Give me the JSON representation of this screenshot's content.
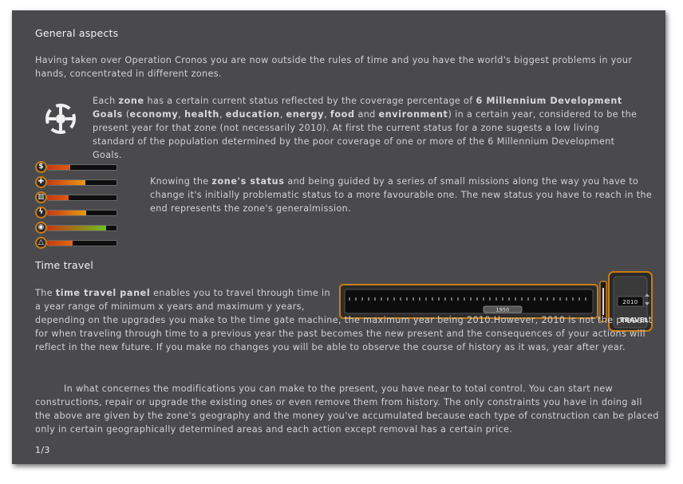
{
  "page": {
    "section1_title": "General aspects",
    "intro": "Having taken over Operation Cronos you are now outside the rules of time and you have the world's biggest problems in your hands, concentrated in different zones.",
    "zone_para": {
      "t1": "Each ",
      "b1": "zone",
      "t2": " has a certain current status reflected by the coverage percentage of ",
      "b2": "6 Millennium Development Goals",
      "t3": " (",
      "b3": "economy",
      "t4": ", ",
      "b4": "health",
      "t5": ", ",
      "b5": "education",
      "t6": ", ",
      "b6": "energy",
      "t7": ", ",
      "b7": "food",
      "t8": " and ",
      "b8": "environment",
      "t9": ") in a certain year, considered to be the present year for that zone (not necessarily 2010). At first the current status for a zone sugests a low living standard of the population determined by the poor coverage of one or more of the 6 Millennium Development Goals."
    },
    "status_para": {
      "t1": "Knowing the ",
      "b1": "zone's status",
      "t2": " and being guided by a series of small missions along the way you have to change it's initially problematic status to a more favourable one. The new status you have to reach in the end represents the zone's generalmission."
    },
    "section2_title": "Time travel",
    "time_para": {
      "t1": "The ",
      "b1": "time travel panel",
      "t2": " enables you to travel through time in a year range of minimum x years and maximum y years,",
      "t3": "depending on the upgrades you make to the time gate machine, the maximum year being 2010.However, 2010 is not the present for when traveling through time to a previous year the past becomes the new present and the consequences of your actions will reflect in the new future. If you make no changes you will be able to observe the course of history as it was, year after year."
    },
    "modif_para": "In what concernes the modifications you can make to the present, you have near to total control. You can start new constructions, repair or upgrade the existing ones or even remove them from history. The only constraints you have in doing all the above are given by the zone's geography and the money you've accumulated because each type of construction can be placed only in certain geographically determined areas and each action except removal has a certain price.",
    "page_number": "1/3"
  },
  "status_bars": [
    {
      "icon": "dollar-icon",
      "glyph": "$",
      "fill": 0.32,
      "color": "#e05a10"
    },
    {
      "icon": "cross-icon",
      "glyph": "✚",
      "fill": 0.55,
      "color": "#e89a10"
    },
    {
      "icon": "school-icon",
      "glyph": "▥",
      "fill": 0.3,
      "color": "#e05a10"
    },
    {
      "icon": "lightning-icon",
      "glyph": "ϟ",
      "fill": 0.56,
      "color": "#e89a10"
    },
    {
      "icon": "food-icon",
      "glyph": "◉",
      "fill": 0.85,
      "color": "#6cc020"
    },
    {
      "icon": "environment-icon",
      "glyph": "△",
      "fill": 0.36,
      "color": "#e06a10"
    }
  ],
  "time_panel": {
    "slider_year": "1950",
    "year_value": "2010",
    "travel_label": "TRAVEL"
  },
  "colors": {
    "background": "#4a4a4d",
    "accent_orange": "#c97c14"
  }
}
